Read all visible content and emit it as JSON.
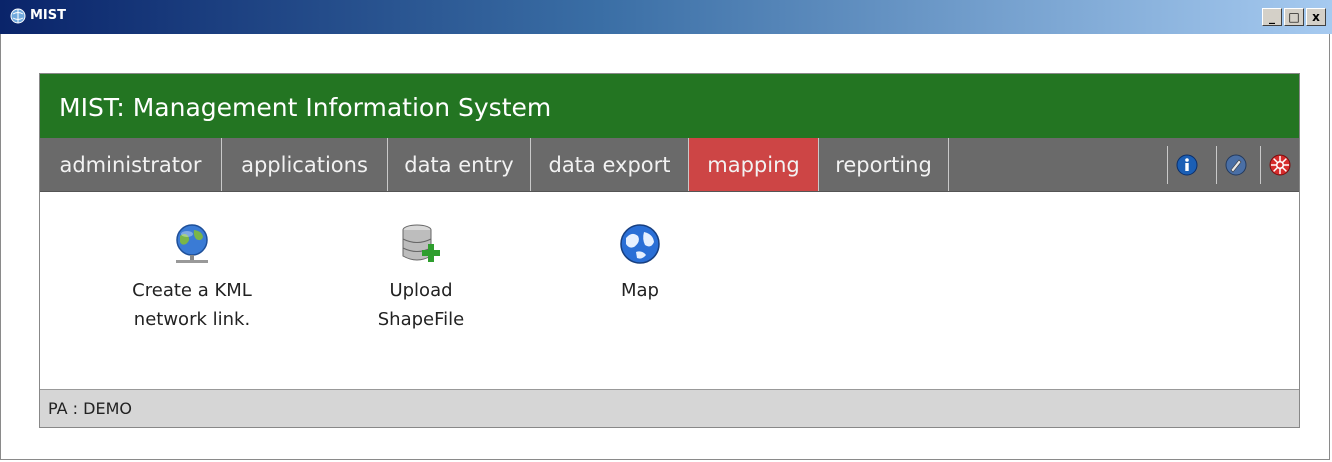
{
  "window": {
    "title": "MIST",
    "controls": {
      "minimize": "_",
      "maximize": "□",
      "close": "x"
    }
  },
  "header": {
    "title": "MIST: Management Information System"
  },
  "nav": {
    "tabs": [
      {
        "label": "administrator",
        "active": false
      },
      {
        "label": "applications",
        "active": false
      },
      {
        "label": "data entry",
        "active": false
      },
      {
        "label": "data export",
        "active": false
      },
      {
        "label": "mapping",
        "active": true
      },
      {
        "label": "reporting",
        "active": false
      }
    ],
    "icons": [
      "info-icon",
      "edit-icon",
      "logout-icon"
    ]
  },
  "apps": [
    {
      "line1": "Create a KML",
      "line2": "network link.",
      "icon": "network-globe-icon"
    },
    {
      "line1": "Upload",
      "line2": "ShapeFile",
      "icon": "database-add-icon"
    },
    {
      "line1": "Map",
      "line2": "",
      "icon": "globe-icon"
    }
  ],
  "footer": {
    "text": "PA : DEMO"
  },
  "colors": {
    "header_green": "#237522",
    "nav_gray": "#6a6a6a",
    "active_tab": "#cd4545"
  }
}
